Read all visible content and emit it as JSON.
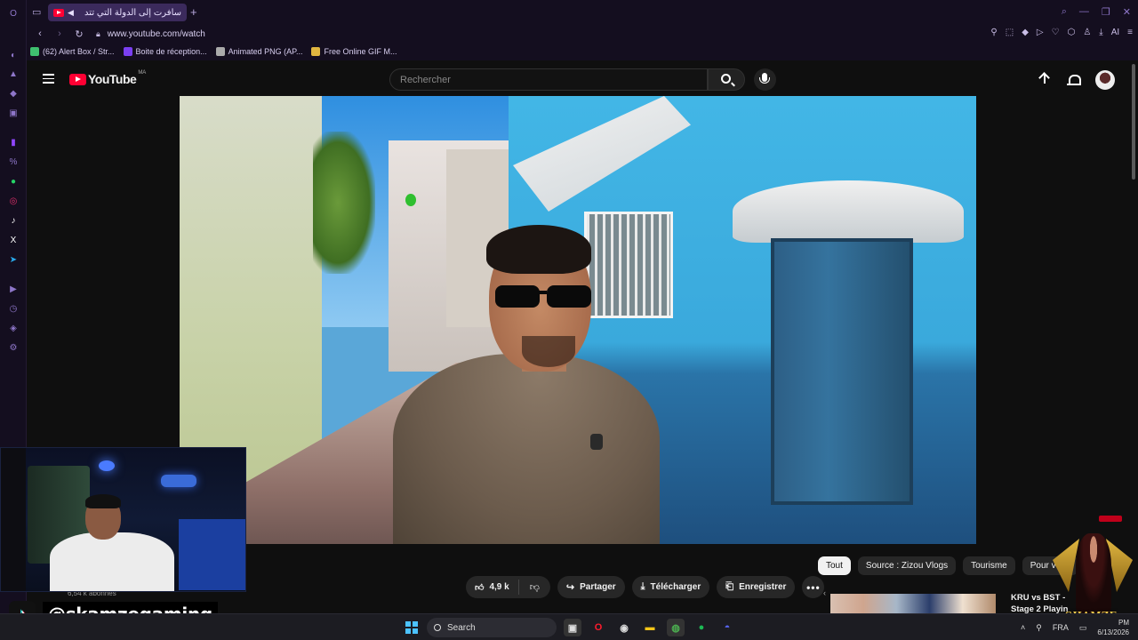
{
  "browser": {
    "tab": {
      "title": "سافرت إلى الدولة التي تتد"
    },
    "new_tab_label": "+",
    "address": {
      "url": "www.youtube.com/watch"
    },
    "toolbar_ai_label": "AI",
    "bookmarks": [
      {
        "label": "(62) Alert Box / Str...",
        "color": "#3fbf6f"
      },
      {
        "label": "Boite de réception...",
        "color": "#7b3ff2"
      },
      {
        "label": "Animated PNG (AP...",
        "color": "#aaaaaa"
      },
      {
        "label": "Free Online GIF M...",
        "color": "#e0b640"
      }
    ]
  },
  "youtube": {
    "logo_word": "YouTube",
    "region": "MA",
    "search_placeholder": "Rechercher",
    "video": {
      "description": "Vlogger in sunglasses walking on a street with blue building"
    },
    "actions": {
      "like_count": "4,9 k",
      "share_label": "Partager",
      "download_label": "Télécharger",
      "save_label": "Enregistrer",
      "more_label": "•••"
    },
    "subscribers": "6,54 k abonnés",
    "chips": [
      "Tout",
      "Source : Zizou Vlogs",
      "Tourisme",
      "Pour vous"
    ],
    "recommended": {
      "title": "KRU vs BST - Stage 2 Playin"
    }
  },
  "overlay": {
    "tiktok_handle": "@skamzegaming",
    "brand": "SHAMZE"
  },
  "taskbar": {
    "search_label": "Search",
    "language": "FRA",
    "time": "PM",
    "date": "6/13/2026"
  },
  "colors": {
    "browser_bg": "#140e1f",
    "youtube_bg": "#0f0f0f",
    "brand_red": "#ff0033",
    "chip_active": "#f1f1f1"
  }
}
